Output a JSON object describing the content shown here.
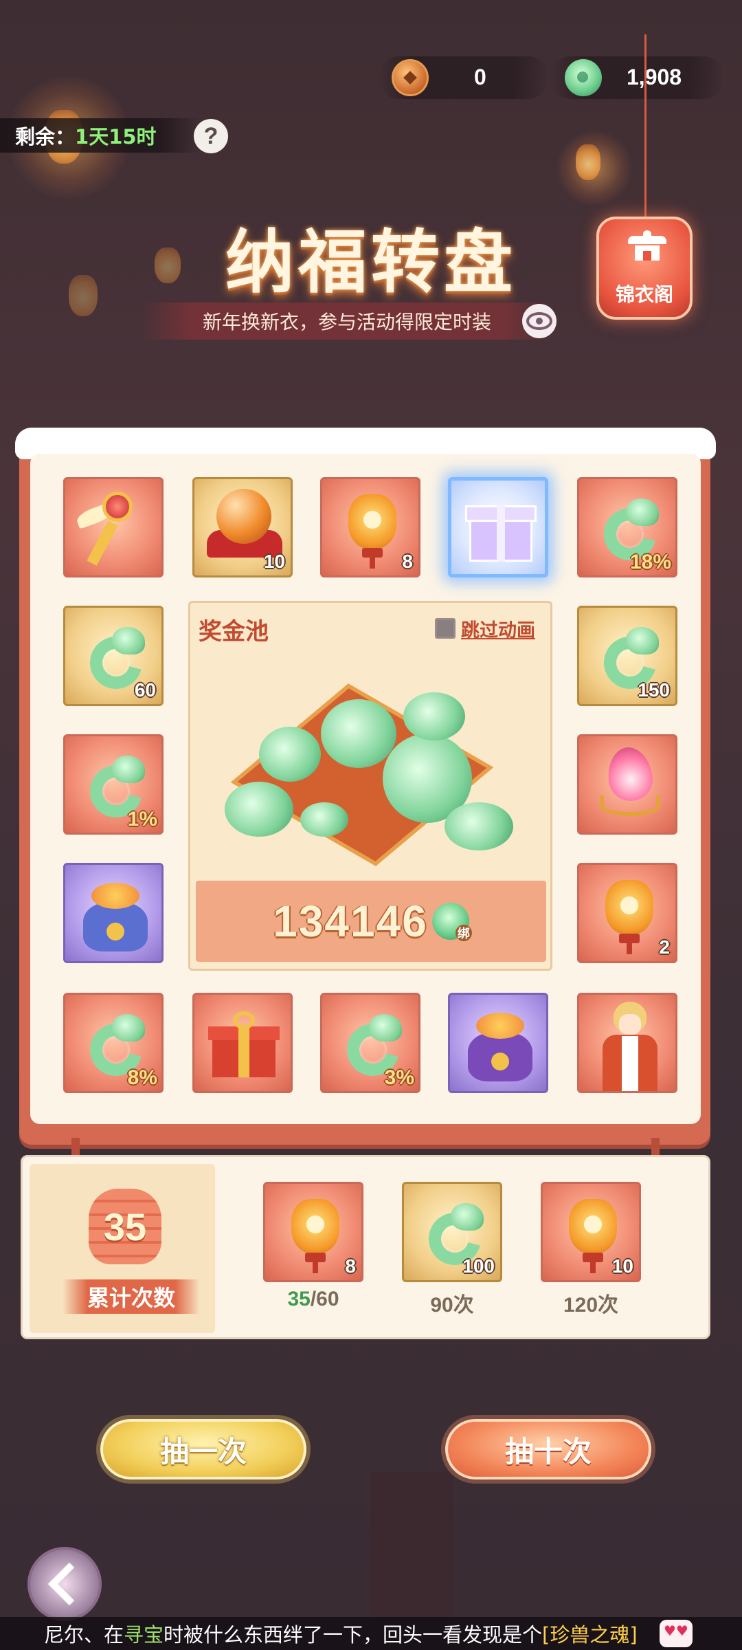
{
  "currency": {
    "coin_value": "0",
    "jade_value": "1,908",
    "coin_icon": "copper-coin-icon",
    "jade_icon": "jade-hook-icon"
  },
  "timer": {
    "label": "剩余：",
    "value": "1天15时"
  },
  "help": {
    "label": "?"
  },
  "header": {
    "title": "纳福转盘",
    "subtitle": "新年换新衣，参与活动得限定时装"
  },
  "jinyige": {
    "label": "锦衣阁"
  },
  "board": {
    "tiles": [
      {
        "kind": "key",
        "qty": "",
        "pct": ""
      },
      {
        "kind": "orb",
        "qty": "10",
        "pct": ""
      },
      {
        "kind": "lantern",
        "qty": "8",
        "pct": ""
      },
      {
        "kind": "gift",
        "qty": "",
        "pct": ""
      },
      {
        "kind": "jade",
        "qty": "",
        "pct": "18%"
      },
      {
        "kind": "jade",
        "qty": "60",
        "pct": ""
      },
      {
        "kind": "jade",
        "qty": "150",
        "pct": ""
      },
      {
        "kind": "jade",
        "qty": "",
        "pct": "1%"
      },
      {
        "kind": "wing",
        "qty": "",
        "pct": ""
      },
      {
        "kind": "bag",
        "qty": "",
        "pct": ""
      },
      {
        "kind": "lantern",
        "qty": "2",
        "pct": ""
      },
      {
        "kind": "jade",
        "qty": "",
        "pct": "8%"
      },
      {
        "kind": "ribbon",
        "qty": "",
        "pct": ""
      },
      {
        "kind": "jade",
        "qty": "",
        "pct": "3%"
      },
      {
        "kind": "bag",
        "qty": "",
        "pct": ""
      },
      {
        "kind": "character",
        "qty": "",
        "pct": ""
      }
    ],
    "selected_index": 3
  },
  "pool": {
    "title": "奖金池",
    "skip_label": "跳过动画",
    "amount": "134146",
    "bound_mark": "绑"
  },
  "progress": {
    "count": "35",
    "count_label": "累计次数",
    "rewards": [
      {
        "kind": "lantern",
        "qty": "8",
        "done": "35",
        "goal": "/60"
      },
      {
        "kind": "jade",
        "qty": "100",
        "done": "",
        "goal": "90次"
      },
      {
        "kind": "lantern",
        "qty": "10",
        "done": "",
        "goal": "120次"
      }
    ]
  },
  "buttons": {
    "draw_one": "抽一次",
    "draw_ten": "抽十次"
  },
  "broadcast": {
    "p1": "尼尔、在",
    "hl1": "寻宝",
    "p2": "时被什么东西绊了一下，回头一看发现是个",
    "hl2": "[珍兽之魂]"
  },
  "colors": {
    "board_frame": "#d56a52",
    "board_inner": "#fcf4e6",
    "accent_green": "#8ff07a",
    "accent_red": "#c24a2e"
  }
}
